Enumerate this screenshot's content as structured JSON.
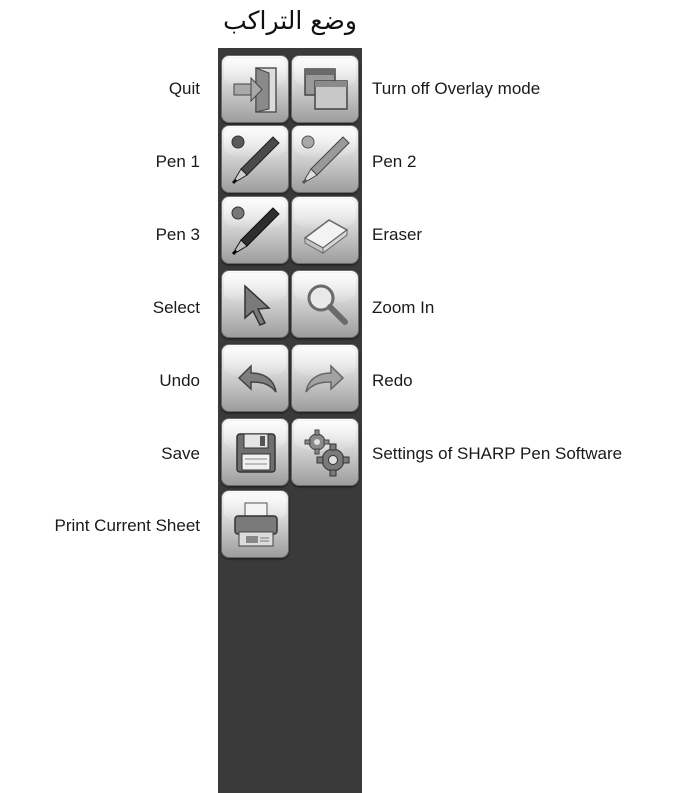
{
  "title": "وضع التراكب",
  "tools": {
    "quit": "Quit",
    "overlay_off": "Turn off Overlay mode",
    "pen1": "Pen 1",
    "pen2": "Pen 2",
    "pen3": "Pen 3",
    "eraser": "Eraser",
    "select": "Select",
    "zoom_in": "Zoom In",
    "undo": "Undo",
    "redo": "Redo",
    "save": "Save",
    "settings": "Settings of SHARP Pen Software",
    "print": "Print Current Sheet"
  },
  "icons": {
    "quit": "exit-door-icon",
    "overlay_off": "overlay-windows-icon",
    "pen1": "pen-icon",
    "pen2": "pen-icon",
    "pen3": "pen-icon",
    "eraser": "eraser-icon",
    "select": "arrow-pointer-icon",
    "zoom_in": "magnifier-icon",
    "undo": "undo-arrow-icon",
    "redo": "redo-arrow-icon",
    "save": "floppy-disk-icon",
    "settings": "gears-icon",
    "print": "printer-icon"
  },
  "colors": {
    "panel": "#3a3a3a",
    "pen1": "#5a5a5a",
    "pen2": "#a8a8a8",
    "pen3": "#2e2e2e"
  }
}
